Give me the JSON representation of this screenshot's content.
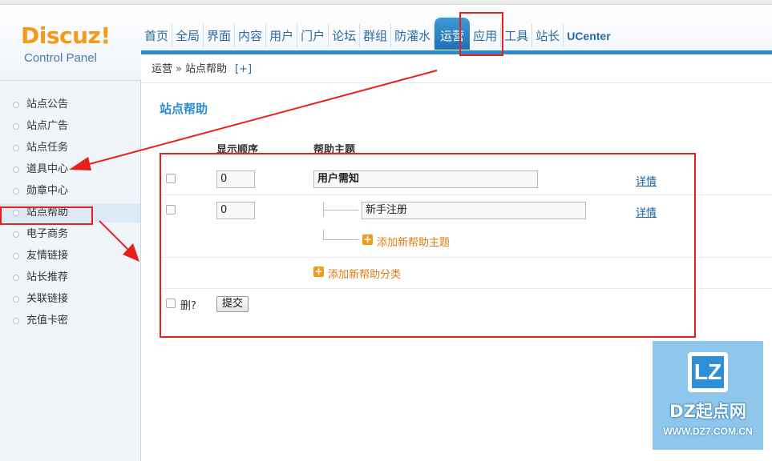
{
  "header": {
    "logo": "Discuz!",
    "logo_sub": "Control Panel"
  },
  "nav": {
    "items": [
      "首页",
      "全局",
      "界面",
      "内容",
      "用户",
      "门户",
      "论坛",
      "群组",
      "防灌水",
      "运营",
      "应用",
      "工具",
      "站长",
      "UCenter"
    ],
    "active": "运营"
  },
  "breadcrumb": {
    "parent": "运营",
    "separator": "»",
    "current": "站点帮助",
    "add": "[+]"
  },
  "sidebar": {
    "items": [
      "站点公告",
      "站点广告",
      "站点任务",
      "道具中心",
      "勋章中心",
      "站点帮助",
      "电子商务",
      "友情链接",
      "站长推荐",
      "关联链接",
      "充值卡密"
    ],
    "active": "站点帮助"
  },
  "main": {
    "title": "站点帮助",
    "columns": {
      "order": "显示顺序",
      "topic": "帮助主题"
    },
    "rows": [
      {
        "order": "0",
        "topic": "用户需知",
        "details": "详情"
      },
      {
        "order": "0",
        "topic": "新手注册",
        "details": "详情"
      }
    ],
    "add_topic": "添加新帮助主题",
    "add_category": "添加新帮助分类",
    "delete_label": "删?",
    "submit": "提交"
  },
  "watermark": {
    "logo_letters": "LZ",
    "title": "DZ起点网",
    "url": "WWW.DZ7.COM.CN"
  },
  "colors": {
    "accent": "#2a8acb",
    "annotation": "#e8201c",
    "add_icon": "#f39a1a"
  }
}
